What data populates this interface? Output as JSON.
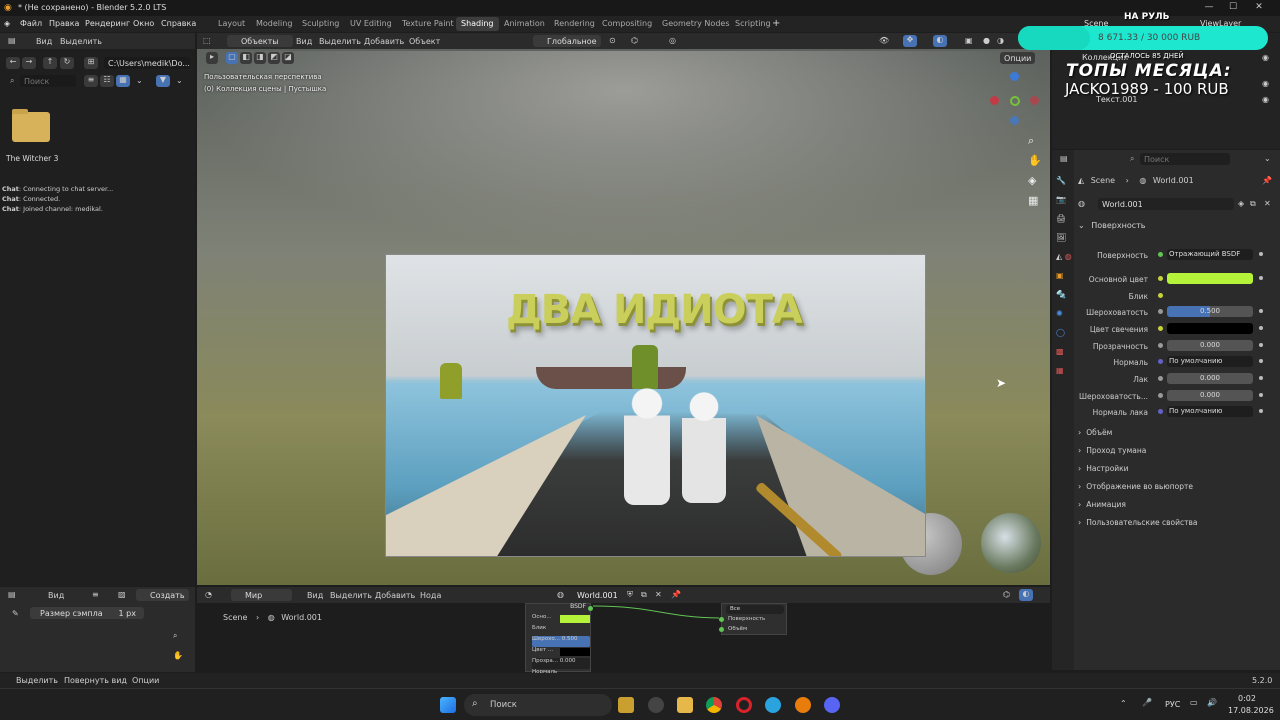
{
  "titlebar": {
    "title": "* (Не сохранено) - Blender 5.2.0 LTS"
  },
  "menu": {
    "file": "Файл",
    "edit": "Правка",
    "render": "Рендеринг",
    "window": "Окно",
    "help": "Справка"
  },
  "workspaces": [
    "Layout",
    "Modeling",
    "Sculpting",
    "UV Editing",
    "Texture Paint",
    "Shading",
    "Animation",
    "Rendering",
    "Compositing",
    "Geometry Nodes",
    "Scripting"
  ],
  "active_workspace": "Shading",
  "scene_tab": "Scene",
  "viewlayer_tab": "ViewLayer",
  "filebrowser": {
    "view": "Вид",
    "select": "Выделить",
    "path": "C:\\Users\\medik\\Do...",
    "search_placeholder": "Поиск",
    "folder_name": "The Witcher 3",
    "chat": [
      {
        "label": "Chat",
        "text": ": Connecting to chat server..."
      },
      {
        "label": "Chat",
        "text": ": Connected."
      },
      {
        "label": "Chat",
        "text": ": Joined channel: medikal."
      }
    ]
  },
  "viewport": {
    "mode": "Объекты",
    "view": "Вид",
    "select": "Выделить",
    "add": "Добавить",
    "object": "Объект",
    "transform": "Глобальное",
    "options": "Опции",
    "info_line1": "Пользовательская перспектива",
    "info_line2": "(0) Коллекция сцены | Пустышка",
    "plane_title": "ДВА ИДИОТА"
  },
  "outliner": {
    "collection": "Коллекция",
    "item": "Текст.001"
  },
  "properties": {
    "search_placeholder": "Поиск",
    "breadcrumb_scene": "Scene",
    "breadcrumb_world": "World.001",
    "world_name": "World.001",
    "section_surface": "Поверхность",
    "rows": [
      {
        "label": "Поверхность",
        "value": "Отражающий BSDF",
        "kind": "shader"
      },
      {
        "label": "Основной цвет",
        "value": "",
        "kind": "color",
        "color": "#b5f23a"
      },
      {
        "label": "Блик",
        "value": "",
        "kind": "empty"
      },
      {
        "label": "Шероховатость",
        "value": "0.500",
        "kind": "slider",
        "fraction": 0.5
      },
      {
        "label": "Цвет свечения",
        "value": "",
        "kind": "color",
        "color": "#000000"
      },
      {
        "label": "Прозрачность",
        "value": "0.000",
        "kind": "num"
      },
      {
        "label": "Нормаль",
        "value": "По умолчанию",
        "kind": "shader"
      },
      {
        "label": "Лак",
        "value": "0.000",
        "kind": "num"
      },
      {
        "label": "Шероховатость...",
        "value": "0.000",
        "kind": "num"
      },
      {
        "label": "Нормаль лака",
        "value": "По умолчанию",
        "kind": "shader"
      }
    ],
    "collapsed": [
      "Объём",
      "Проход тумана",
      "Настройки",
      "Отображение во вьюпорте",
      "Анимация",
      "Пользовательские свойства"
    ]
  },
  "bottom_left": {
    "view": "Вид",
    "create": "Создать",
    "sample_label": "Размер сэмпла",
    "sample_value": "1 px"
  },
  "node_editor": {
    "world_mode": "Мир",
    "view": "Вид",
    "select": "Выделить",
    "add": "Добавить",
    "node": "Нода",
    "world": "World.001",
    "breadcrumb_scene": "Scene",
    "breadcrumb_world": "World.001",
    "bsdf_title": "BSDF",
    "bsdf_rows": [
      "Осно...",
      "Блик",
      "Шерохо... 0.500",
      "Цвет ...",
      "Прозра... 0.000",
      "Нормаль"
    ],
    "output_select": "Все",
    "output_rows": [
      "Поверхность",
      "Объём"
    ]
  },
  "statusbar": {
    "select": "Выделить",
    "rotate": "Повернуть вид",
    "options": "Опции",
    "version": "5.2.0"
  },
  "overlay": {
    "label_top": "НА РУЛЬ",
    "progress": "8 671.33 / 30 000 RUB",
    "progress_fraction": 0.289,
    "remaining": "ОСТАЛОСЬ 85 ДНЕЙ",
    "tops": "ТОПЫ МЕСЯЦА:",
    "donor": "JACKO1989 - 100 RUB"
  },
  "taskbar": {
    "search": "Поиск",
    "lang": "РУС",
    "time": "0:02",
    "date": "17.08.2026"
  }
}
